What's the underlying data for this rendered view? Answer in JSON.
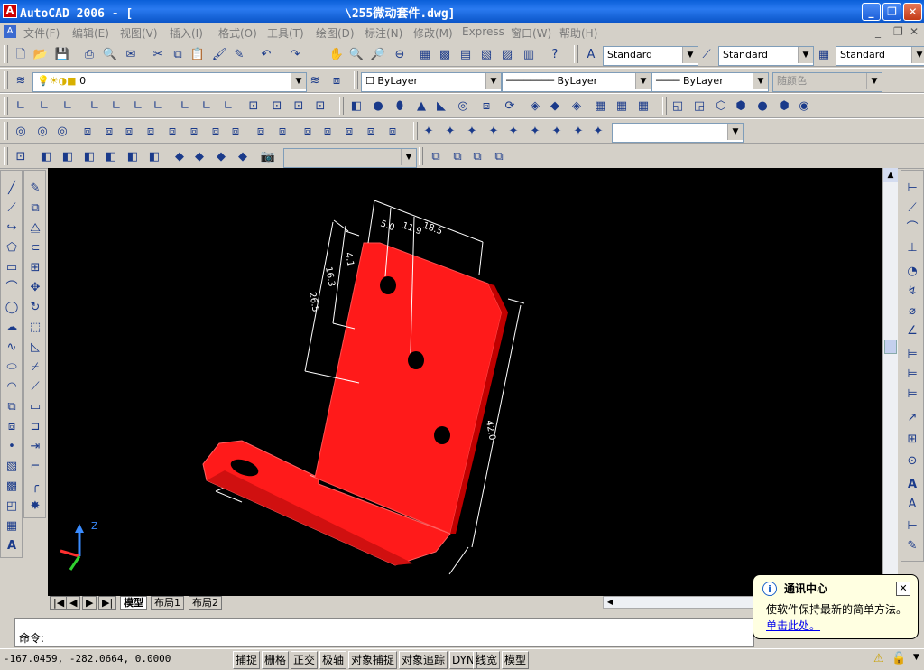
{
  "window": {
    "title": "AutoCAD 2006 - [                              \\255微动套件.dwg]",
    "min_glyph": "_",
    "max_glyph": "❐",
    "close_glyph": "✕"
  },
  "menu": [
    "文件(F)",
    "编辑(E)",
    "视图(V)",
    "插入(I)",
    "格式(O)",
    "工具(T)",
    "绘图(D)",
    "标注(N)",
    "修改(M)",
    "Express",
    "窗口(W)",
    "帮助(H)"
  ],
  "styles": {
    "text_style": "Standard",
    "dim_style": "Standard",
    "table_style": "Standard"
  },
  "layers": {
    "current_layer": "0",
    "color": "ByLayer",
    "linetype": "ByLayer",
    "lineweight": "ByLayer",
    "plot_style": "随颜色"
  },
  "model": {
    "dimensions": [
      "5.0",
      "11.9",
      "18.5",
      "4.1",
      "16.3",
      "26.5",
      "42.0"
    ],
    "colors": {
      "part": "#ff1a1a",
      "part_dark": "#b80000",
      "dim": "#ffffff",
      "background": "#000000"
    },
    "ucs": {
      "z_label": "Z"
    }
  },
  "tabs": [
    "模型",
    "布局1",
    "布局2"
  ],
  "command": {
    "prompt": "命令:"
  },
  "status": {
    "coords": "-167.0459, -282.0664, 0.0000",
    "buttons": [
      "捕捉",
      "栅格",
      "正交",
      "极轴",
      "对象捕捉",
      "对象追踪",
      "DYN",
      "线宽",
      "模型"
    ]
  },
  "notification": {
    "title": "通讯中心",
    "message": "使软件保持最新的简单方法。",
    "link": "单击此处。"
  }
}
